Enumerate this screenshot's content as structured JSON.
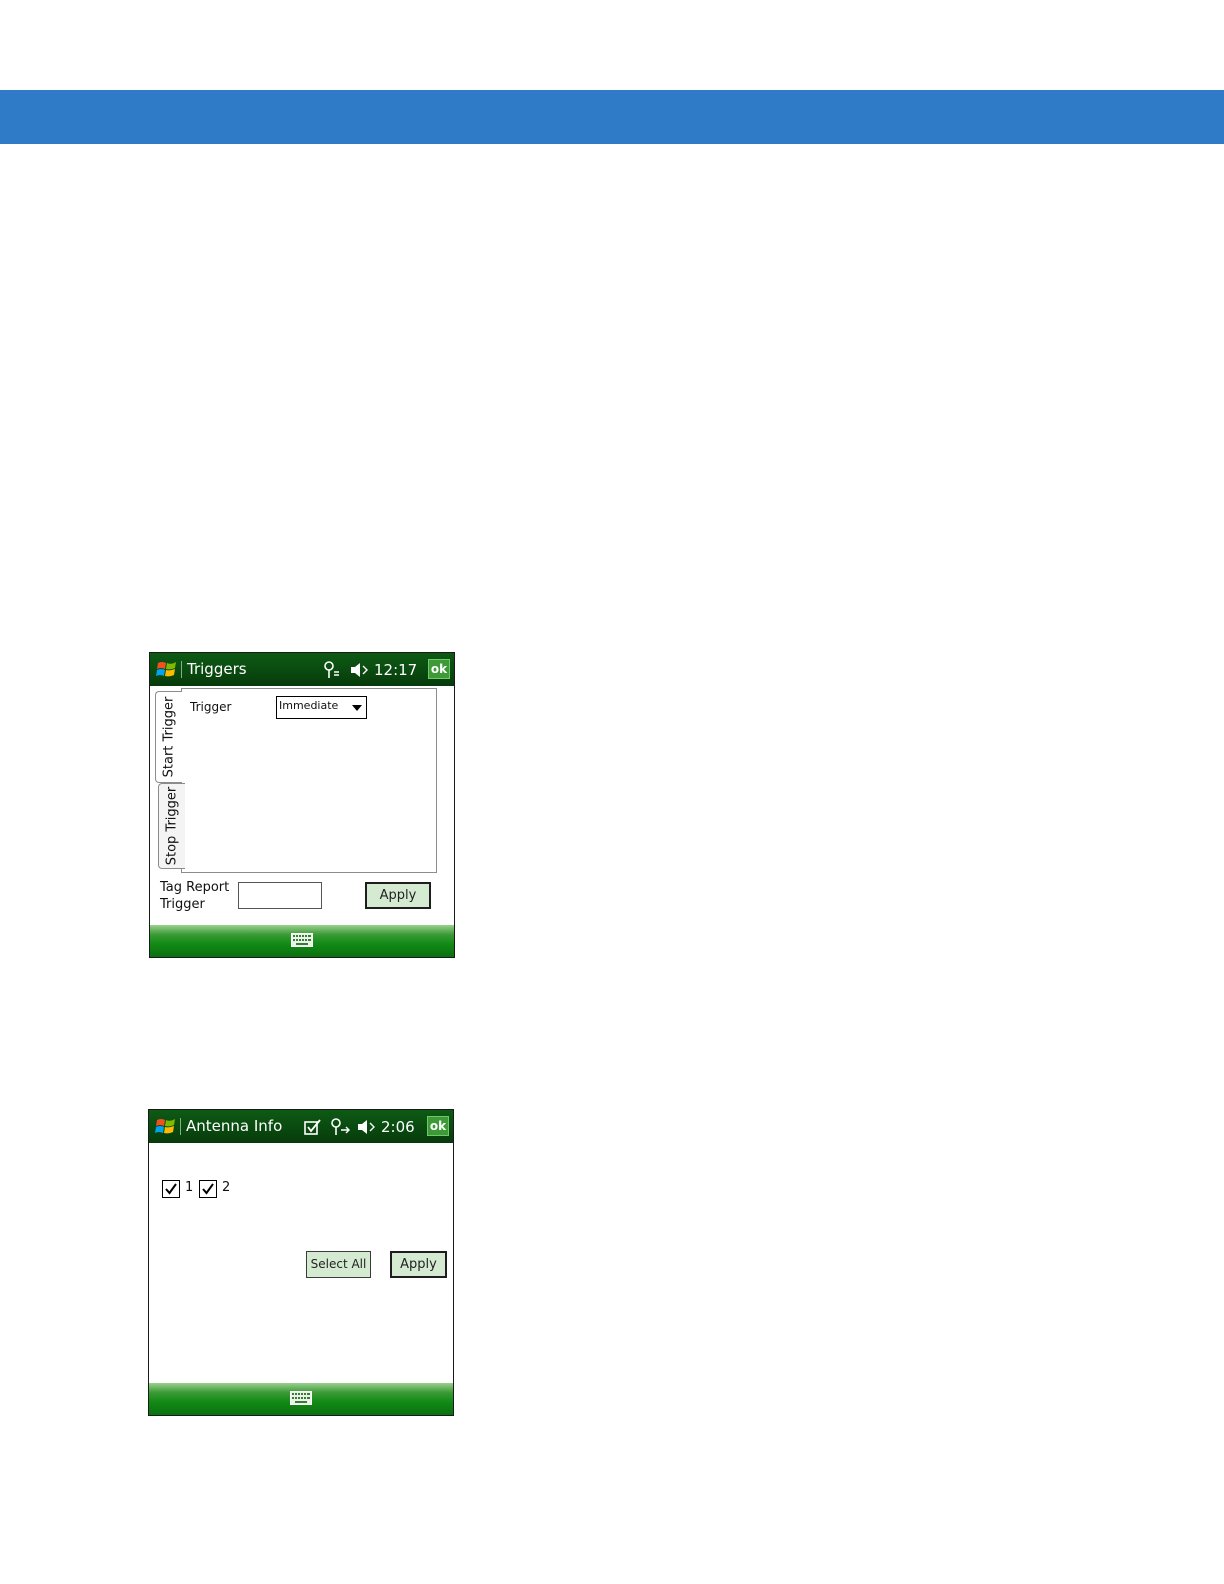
{
  "colors": {
    "header_band": "#2f7bc8",
    "titlebar_green": "#0a4b10",
    "button_fill": "#d4ebd2"
  },
  "triggers_screen": {
    "title": "Triggers",
    "clock": "12:17",
    "ok_label": "ok",
    "status_icons": [
      "connectivity-icon",
      "speaker-muted-icon"
    ],
    "tabs": [
      {
        "label": "Start Trigger",
        "selected": true
      },
      {
        "label": "Stop Trigger",
        "selected": false
      }
    ],
    "trigger_label": "Trigger",
    "trigger_value": "Immediate",
    "tag_report_label_line1": "Tag Report",
    "tag_report_label_line2": "Trigger",
    "tag_report_value": "",
    "apply_label": "Apply",
    "softbar_icon": "keyboard-icon"
  },
  "antenna_screen": {
    "title": "Antenna Info",
    "clock": "2:06",
    "ok_label": "ok",
    "status_icons": [
      "checklist-icon",
      "connectivity-icon",
      "speaker-muted-icon"
    ],
    "antennas": [
      {
        "label": "1",
        "checked": true
      },
      {
        "label": "2",
        "checked": true
      }
    ],
    "select_all_label": "Select All",
    "apply_label": "Apply",
    "softbar_icon": "keyboard-icon"
  }
}
